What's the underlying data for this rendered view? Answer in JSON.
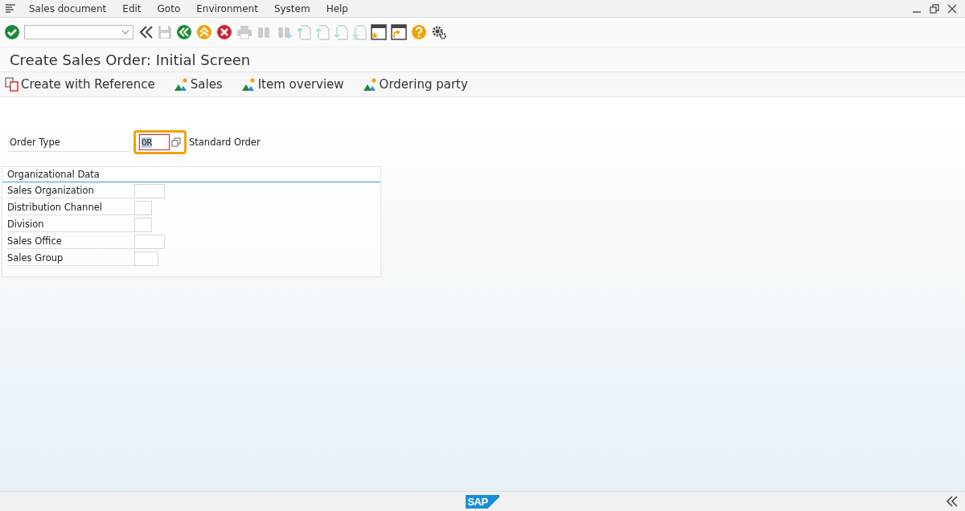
{
  "menu": [
    "Sales document",
    "Edit",
    "Goto",
    "Environment",
    "System",
    "Help"
  ],
  "toolbar": [
    {
      "kind": "enter",
      "disabled": false
    },
    {
      "kind": "command",
      "disabled": false
    },
    {
      "kind": "collapse",
      "disabled": false
    },
    {
      "kind": "save",
      "disabled": true
    },
    {
      "kind": "back",
      "disabled": false
    },
    {
      "kind": "exit",
      "disabled": false
    },
    {
      "kind": "cancel",
      "disabled": false
    },
    {
      "kind": "print",
      "disabled": true
    },
    {
      "kind": "find",
      "disabled": true
    },
    {
      "kind": "findnext",
      "disabled": true
    },
    {
      "kind": "first",
      "disabled": true
    },
    {
      "kind": "prev",
      "disabled": true
    },
    {
      "kind": "next",
      "disabled": true
    },
    {
      "kind": "last",
      "disabled": true
    },
    {
      "kind": "session",
      "disabled": false
    },
    {
      "kind": "shortcut",
      "disabled": false
    },
    {
      "kind": "help",
      "disabled": false
    },
    {
      "kind": "settings",
      "disabled": false
    }
  ],
  "title": "Create Sales Order: Initial Screen",
  "app_toolbar": [
    {
      "kind": "reference",
      "label": "Create with Reference"
    },
    {
      "kind": "view",
      "label": "Sales"
    },
    {
      "kind": "view",
      "label": "Item overview"
    },
    {
      "kind": "view",
      "label": "Ordering party"
    }
  ],
  "order_type": {
    "label": "Order Type",
    "value": "OR",
    "focused": true,
    "description": "Standard Order"
  },
  "org_data": {
    "title": "Organizational Data",
    "fields": [
      {
        "label": "Sales Organization"
      },
      {
        "label": "Distribution Channel"
      },
      {
        "label": "Division"
      },
      {
        "label": "Sales Office"
      },
      {
        "label": "Sales Group"
      }
    ]
  },
  "footer": {
    "logo": "SAP"
  }
}
